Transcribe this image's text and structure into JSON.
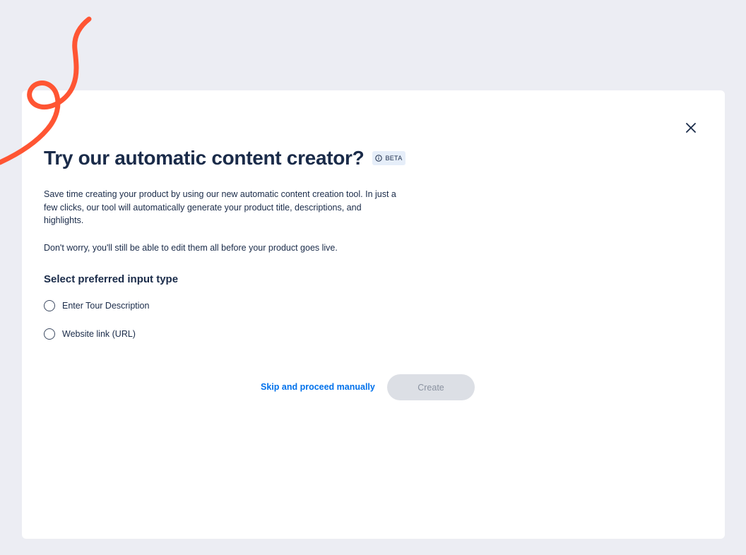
{
  "modal": {
    "title": "Try our automatic content creator?",
    "badge": "BETA",
    "description": "Save time creating your product by using our new automatic content creation tool. In just a few clicks, our tool will automatically generate your product title, descriptions, and highlights.",
    "note": "Don't worry, you'll still be able to edit them all before your product goes live.",
    "input_section": {
      "title": "Select preferred input type",
      "options": [
        {
          "label": "Enter Tour Description",
          "selected": false
        },
        {
          "label": "Website link (URL)",
          "selected": false
        }
      ]
    },
    "actions": {
      "skip_label": "Skip and proceed manually",
      "create_label": "Create",
      "create_disabled": true
    }
  },
  "icons": {
    "close": "close-icon",
    "info": "info-icon"
  },
  "colors": {
    "background": "#ecedf3",
    "heading": "#1a2b49",
    "link": "#0071eb",
    "accent_squiggle": "#ff5533",
    "disabled_button": "#dcdfe5"
  }
}
